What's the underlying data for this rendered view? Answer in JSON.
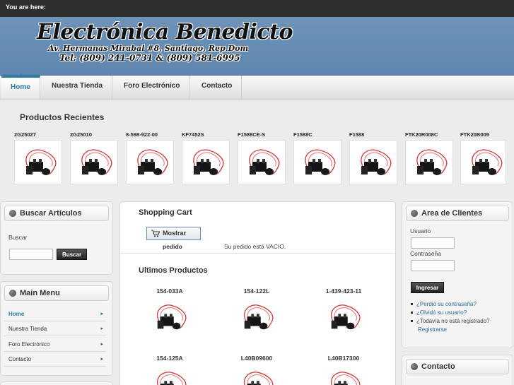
{
  "breadcrumb": {
    "label": "You are here:"
  },
  "header": {
    "logo_line1": "Electrónica Benedicto",
    "logo_line2": "Av. Hermanas Mirabal #8, Santiago, Rep.Dom",
    "logo_line3": "Tel: (809) 241-0731 & (809) 581-6995"
  },
  "nav": {
    "items": [
      "Home",
      "Nuestra Tienda",
      "Foro Electrónico",
      "Contacto"
    ],
    "active": "Home"
  },
  "recent": {
    "title": "Productos Recientes",
    "items": [
      "2G25027",
      "2G25010",
      "8-598-922-00",
      "KF7452S",
      "F1588CE-S",
      "F1588C",
      "F1588",
      "FTK20R008C",
      "FTK20B009"
    ]
  },
  "search": {
    "title": "Buscar Artículos",
    "label": "Buscar",
    "button": "Buscar",
    "value": ""
  },
  "main_menu": {
    "title": "Main Menu",
    "items": [
      "Home",
      "Nuestra Tienda",
      "Foro Electrónico",
      "Contacto"
    ],
    "arrow": "▸"
  },
  "cart": {
    "title": "Shopping Cart",
    "show_button": "Mostrar",
    "order_label": "pedido",
    "status": "Su pedido está VACIO."
  },
  "latest": {
    "title": "Ultimos Productos",
    "items": [
      "154-033A",
      "154-122L",
      "1-439-423-11",
      "154-125A",
      "L40B09600",
      "L40B17300"
    ]
  },
  "login": {
    "title": "Area de Clientes",
    "username_label": "Usuario",
    "password_label": "Contraseña",
    "button": "Ingresar",
    "username_value": "",
    "password_value": "",
    "links": [
      "¿Perdió su contraseña?",
      "¿Olvidó su usuario?",
      "¿Todavía no está registrado?",
      "Registrarse"
    ]
  },
  "contact_panel": {
    "title": "Contacto"
  },
  "colors": {
    "accent": "#2a7fa0",
    "banner": "#6d93b9",
    "topbar": "#2f2f2f"
  }
}
